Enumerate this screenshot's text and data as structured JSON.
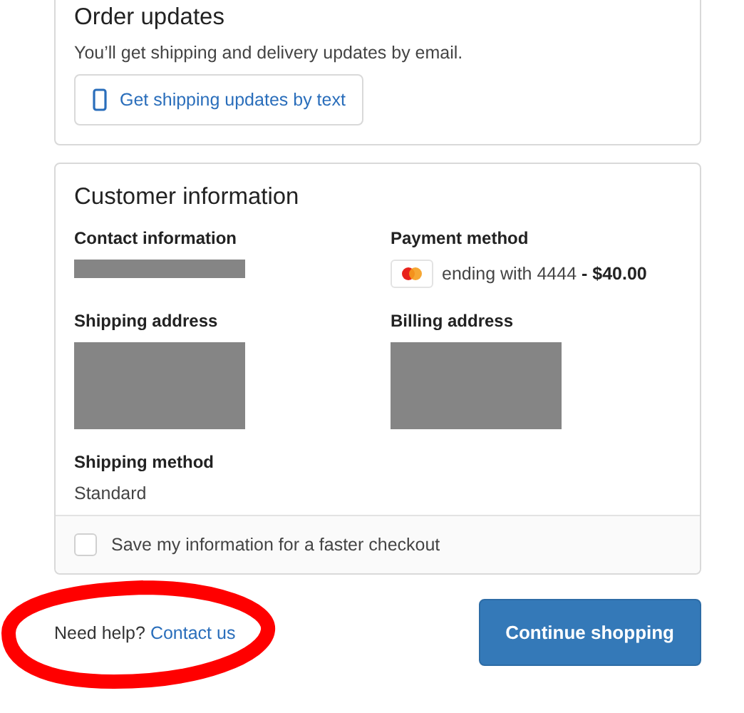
{
  "order_updates": {
    "title": "Order updates",
    "description": "You’ll get shipping and delivery updates by email.",
    "text_button": "Get shipping updates by text"
  },
  "customer_information": {
    "title": "Customer information",
    "sections": [
      {
        "label": "Contact information",
        "value": {
          "kind": "redacted_line"
        }
      },
      {
        "label": "Payment method",
        "value": {
          "kind": "payment",
          "text": "ending with 4444 **- $40.00**"
        }
      },
      {
        "label": "Shipping address",
        "value": {
          "kind": "redacted_block"
        }
      },
      {
        "label": "Billing address",
        "value": {
          "kind": "redacted_block"
        }
      },
      {
        "label": "Shipping method",
        "value": {
          "kind": "text",
          "text": "Standard"
        }
      }
    ],
    "save_option": {
      "label": "Save my information for a faster checkout",
      "checked": false
    }
  },
  "footer": {
    "help_text": "Need help?",
    "help_link": "Contact us",
    "continue_button": "Continue shopping"
  },
  "annotation": {
    "kind": "ellipse"
  }
}
